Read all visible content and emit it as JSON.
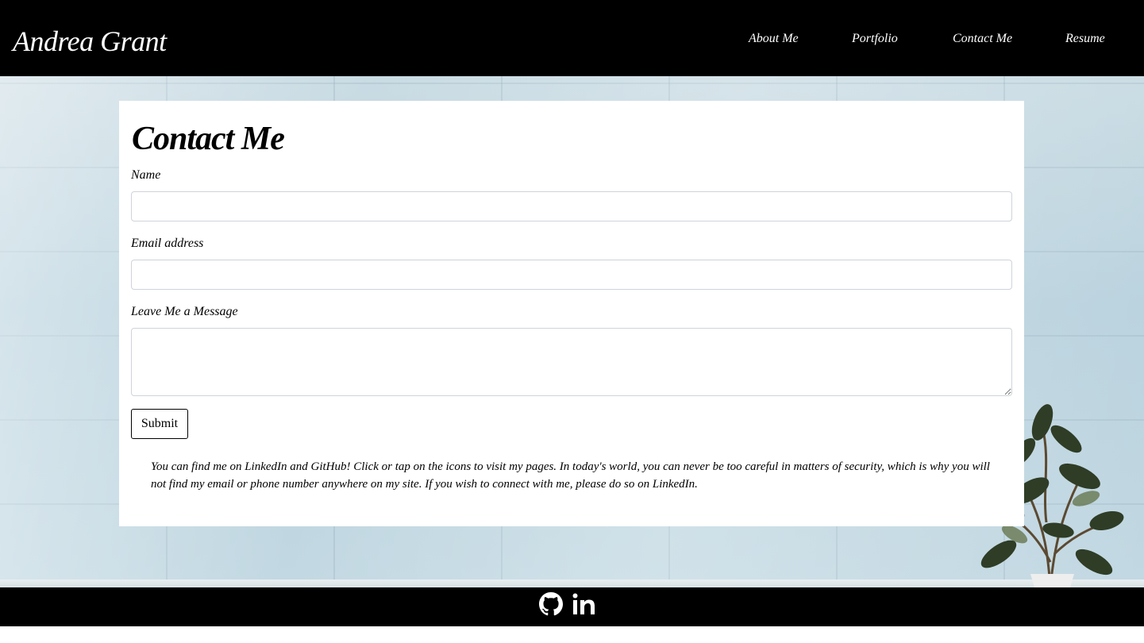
{
  "header": {
    "brand": "Andrea Grant",
    "nav": {
      "about": "About Me",
      "portfolio": "Portfolio",
      "contact": "Contact Me",
      "resume": "Resume"
    }
  },
  "contact_form": {
    "title": "Contact Me",
    "name_label": "Name",
    "name_value": "",
    "email_label": "Email address",
    "email_value": "",
    "message_label": "Leave Me a Message",
    "message_value": "",
    "submit_label": "Submit",
    "note": "You can find me on LinkedIn and GitHub! Click or tap on the icons to visit my pages. In today's world, you can never be too careful in matters of security, which is why you will not find my email or phone number anywhere on my site. If you wish to connect with me, please do so on LinkedIn."
  },
  "footer": {
    "icons": [
      "github-icon",
      "linkedin-icon"
    ]
  },
  "colors": {
    "navbar": "#000000",
    "footer": "#000000",
    "card": "#ffffff",
    "text": "#000000",
    "input_border": "#ced4da"
  }
}
